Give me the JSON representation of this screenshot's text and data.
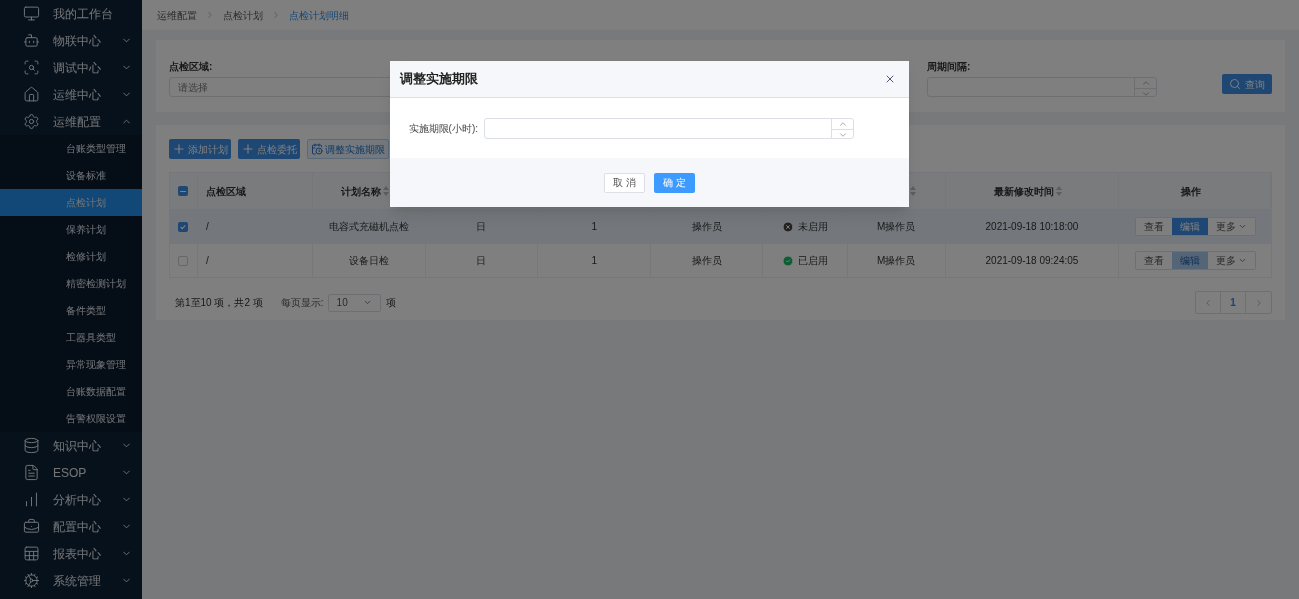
{
  "sidebar": {
    "items": [
      {
        "label": "我的工作台"
      },
      {
        "label": "物联中心",
        "expanded": false
      },
      {
        "label": "调试中心",
        "expanded": false
      },
      {
        "label": "运维中心",
        "expanded": false
      },
      {
        "label": "运维配置",
        "expanded": true,
        "children": [
          {
            "label": "台账类型管理",
            "selected": false
          },
          {
            "label": "设备标准",
            "selected": false
          },
          {
            "label": "点检计划",
            "selected": true
          },
          {
            "label": "保养计划",
            "selected": false
          },
          {
            "label": "检修计划",
            "selected": false
          },
          {
            "label": "精密检测计划",
            "selected": false
          },
          {
            "label": "备件类型",
            "selected": false
          },
          {
            "label": "工器具类型",
            "selected": false
          },
          {
            "label": "异常现象管理",
            "selected": false
          },
          {
            "label": "台账数据配置",
            "selected": false
          },
          {
            "label": "告警权限设置",
            "selected": false
          }
        ]
      },
      {
        "label": "知识中心",
        "expanded": false
      },
      {
        "label": "ESOP",
        "expanded": false
      },
      {
        "label": "分析中心",
        "expanded": false
      },
      {
        "label": "配置中心",
        "expanded": false
      },
      {
        "label": "报表中心",
        "expanded": false
      },
      {
        "label": "系统管理",
        "expanded": false
      }
    ]
  },
  "breadcrumb": [
    "运维配置",
    "点检计划",
    "点检计划明细"
  ],
  "filters": [
    {
      "kind": "select",
      "label": "点检区域:",
      "placeholder": "请选择"
    },
    {
      "kind": "number",
      "label": "周期间隔:"
    }
  ],
  "query_button": "查询",
  "toolbar": [
    {
      "kind": "add",
      "label": "添加计划"
    },
    {
      "kind": "add",
      "label": "点检委托"
    },
    {
      "kind": "calendar",
      "label": "调整实施期限"
    }
  ],
  "table": {
    "select_all": {
      "indeterminate": true
    },
    "columns": [
      {
        "label": "点检区域",
        "sortable": false
      },
      {
        "label": "计划名称",
        "sortable": true
      },
      null,
      null,
      null,
      null,
      {
        "sortable": true
      },
      {
        "label": "最新修改时间",
        "sortable": true
      },
      {
        "label": "操作",
        "sortable": false
      }
    ],
    "rows": [
      {
        "selected": true,
        "cells": [
          {
            "kind": "text",
            "text": "/"
          },
          {
            "kind": "text",
            "text": "电容式充磁机点检"
          },
          {
            "kind": "text",
            "text": "日"
          },
          {
            "kind": "text",
            "text": "1"
          },
          {
            "kind": "text",
            "text": "操作员"
          },
          {
            "kind": "status",
            "text": "未启用",
            "enabled": false
          },
          {
            "kind": "text",
            "text": "M操作员"
          },
          {
            "kind": "text",
            "text": "2021-09-18 10:18:00"
          }
        ],
        "actions": [
          {
            "kind": "default",
            "label": "查看",
            "disabled": false
          },
          {
            "kind": "primary",
            "label": "编辑",
            "disabled": false
          },
          {
            "kind": "dropdown",
            "label": "更多",
            "disabled": false
          }
        ]
      },
      {
        "selected": false,
        "cells": [
          {
            "kind": "text",
            "text": "/"
          },
          {
            "kind": "text",
            "text": "设备日检"
          },
          {
            "kind": "text",
            "text": "日"
          },
          {
            "kind": "text",
            "text": "1"
          },
          {
            "kind": "text",
            "text": "操作员"
          },
          {
            "kind": "status",
            "text": "已启用",
            "enabled": true
          },
          {
            "kind": "text",
            "text": "M操作员"
          },
          {
            "kind": "text",
            "text": "2021-09-18 09:24:05"
          }
        ],
        "actions": [
          {
            "kind": "default",
            "label": "查看",
            "disabled": false
          },
          {
            "kind": "primary",
            "label": "编辑",
            "disabled": true
          },
          {
            "kind": "dropdown",
            "label": "更多",
            "disabled": false
          }
        ]
      }
    ]
  },
  "pagination": {
    "summary": "第1至10 项，共2  项",
    "page_size_label": "每页显示:",
    "page_size": "10",
    "unit": "项",
    "pages": [
      {
        "label": "1",
        "selected": true
      }
    ]
  },
  "dialog": {
    "title": "调整实施期限",
    "field_label": "实施期限(小时):",
    "buttons": [
      {
        "kind": "default",
        "label": "取 消"
      },
      {
        "kind": "primary",
        "label": "确 定"
      }
    ]
  }
}
